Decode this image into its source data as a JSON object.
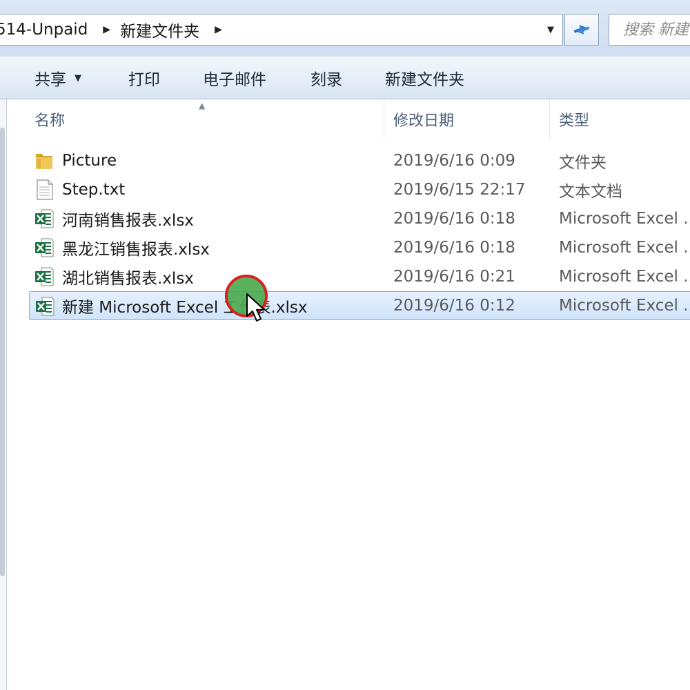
{
  "address": {
    "crumbs": [
      "514-Unpaid",
      "新建文件夹"
    ],
    "dropdown_icon": "chevron-down-icon",
    "refresh_icon": "refresh-icon"
  },
  "search": {
    "placeholder": "搜索 新建"
  },
  "toolbar": {
    "share": "共享",
    "print": "打印",
    "email": "电子邮件",
    "burn": "刻录",
    "new_folder": "新建文件夹"
  },
  "columns": {
    "name": "名称",
    "modified": "修改日期",
    "type": "类型"
  },
  "files": [
    {
      "name": "Picture",
      "modified": "2019/6/16 0:09",
      "type": "文件夹",
      "icon": "folder-icon"
    },
    {
      "name": "Step.txt",
      "modified": "2019/6/15 22:17",
      "type": "文本文档",
      "icon": "text-file-icon"
    },
    {
      "name": "河南销售报表.xlsx",
      "modified": "2019/6/16 0:18",
      "type": "Microsoft Excel ...",
      "icon": "excel-file-icon"
    },
    {
      "name": "黑龙江销售报表.xlsx",
      "modified": "2019/6/16 0:18",
      "type": "Microsoft Excel ...",
      "icon": "excel-file-icon"
    },
    {
      "name": "湖北销售报表.xlsx",
      "modified": "2019/6/16 0:21",
      "type": "Microsoft Excel ...",
      "icon": "excel-file-icon"
    },
    {
      "name": "新建 Microsoft Excel 工作表.xlsx",
      "modified": "2019/6/16 0:12",
      "type": "Microsoft Excel ...",
      "icon": "excel-file-icon",
      "selected": true
    }
  ],
  "colors": {
    "selection_fill": "#cfe4fb",
    "selection_border": "#84acdd",
    "click_marker_fill": "#4caa50",
    "click_marker_ring": "#d8201c",
    "excel_green": "#1e7145",
    "folder_yellow": "#e8b83a"
  }
}
